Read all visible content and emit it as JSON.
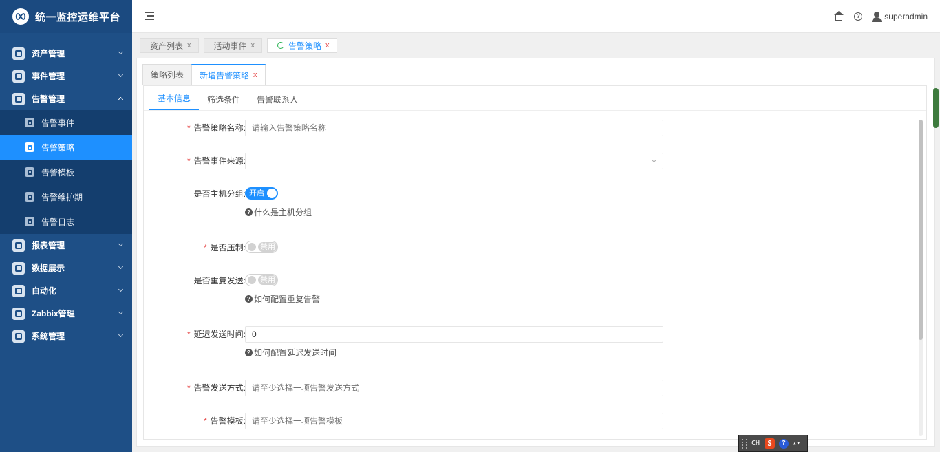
{
  "app": {
    "title": "统一监控运维平台"
  },
  "sidebar": {
    "items": [
      {
        "label": "资产管理",
        "expanded": false
      },
      {
        "label": "事件管理",
        "expanded": false
      },
      {
        "label": "告警管理",
        "expanded": true,
        "children": [
          {
            "label": "告警事件",
            "active": false
          },
          {
            "label": "告警策略",
            "active": true
          },
          {
            "label": "告警模板",
            "active": false
          },
          {
            "label": "告警维护期",
            "active": false
          },
          {
            "label": "告警日志",
            "active": false
          }
        ]
      },
      {
        "label": "报表管理",
        "expanded": false
      },
      {
        "label": "数据展示",
        "expanded": false
      },
      {
        "label": "自动化",
        "expanded": false
      },
      {
        "label": "Zabbix管理",
        "expanded": false
      },
      {
        "label": "系统管理",
        "expanded": false
      }
    ]
  },
  "header": {
    "username": "superadmin"
  },
  "page_tabs": [
    {
      "label": "资产列表",
      "close": "x"
    },
    {
      "label": "活动事件",
      "close": "x"
    },
    {
      "label": "告警策略",
      "close": "x",
      "active": true
    }
  ],
  "inner_tabs": [
    {
      "label": "策略列表"
    },
    {
      "label": "新增告警策略",
      "close": "x",
      "active": true
    }
  ],
  "sub_tabs": [
    {
      "label": "基本信息",
      "active": true
    },
    {
      "label": "筛选条件"
    },
    {
      "label": "告警联系人"
    }
  ],
  "form": {
    "policy_name": {
      "label": "告警策略名称:",
      "required": true,
      "placeholder": "请输入告警策略名称"
    },
    "event_source": {
      "label": "告警事件来源:",
      "required": true,
      "value": ""
    },
    "host_group": {
      "label": "是否主机分组:",
      "required": false,
      "switch_text": "开启",
      "on": true,
      "help": "什么是主机分组"
    },
    "suppress": {
      "label": "是否压制:",
      "required": true,
      "switch_text": "禁用",
      "on": false
    },
    "repeat_send": {
      "label": "是否重复发送:",
      "required": false,
      "switch_text": "禁用",
      "on": false,
      "help": "如何配置重复告警"
    },
    "delay": {
      "label": "延迟发送时间:",
      "required": true,
      "value": "0",
      "help": "如何配置延迟发送时间"
    },
    "send_method": {
      "label": "告警发送方式:",
      "required": true,
      "placeholder": "请至少选择一项告警发送方式"
    },
    "template": {
      "label": "告警模板:",
      "required": true,
      "placeholder": "请至少选择一项告警模板"
    }
  },
  "ime": {
    "lang": "CH",
    "logo": "S",
    "help": "?"
  }
}
